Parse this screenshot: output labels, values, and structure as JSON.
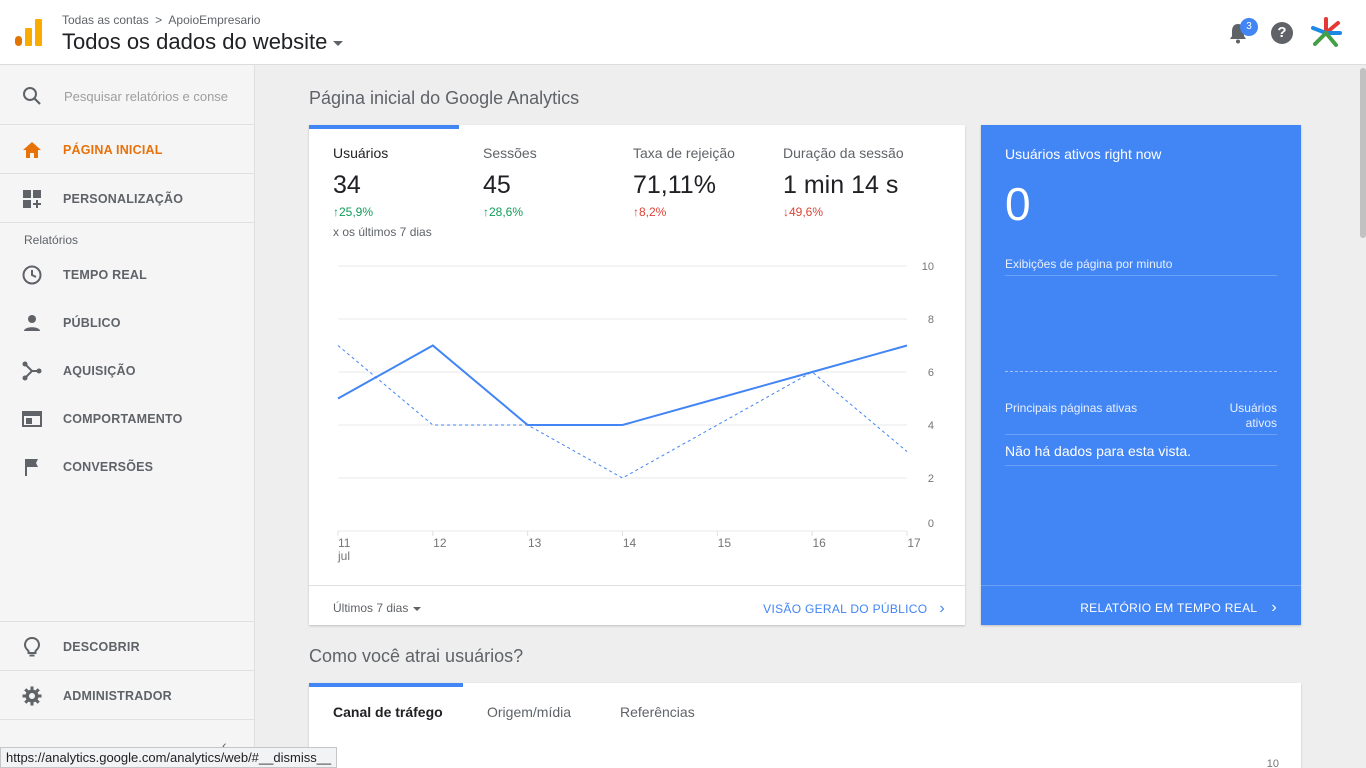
{
  "header": {
    "breadcrumb_root": "Todas as contas",
    "breadcrumb_sep": ">",
    "breadcrumb_account": "ApoioEmpresario",
    "view_title": "Todos os dados do website",
    "notification_count": "3",
    "help_glyph": "?"
  },
  "sidebar": {
    "search_placeholder": "Pesquisar relatórios e conse",
    "section_label": "Relatórios",
    "items": [
      {
        "label": "PÁGINA INICIAL",
        "icon": "home-icon"
      },
      {
        "label": "PERSONALIZAÇÃO",
        "icon": "dashboard-icon"
      },
      {
        "label": "TEMPO REAL",
        "icon": "clock-icon"
      },
      {
        "label": "PÚBLICO",
        "icon": "person-icon"
      },
      {
        "label": "AQUISIÇÃO",
        "icon": "acquisition-icon"
      },
      {
        "label": "COMPORTAMENTO",
        "icon": "browser-window-icon"
      },
      {
        "label": "CONVERSÕES",
        "icon": "flag-icon"
      },
      {
        "label": "DESCOBRIR",
        "icon": "lightbulb-icon"
      },
      {
        "label": "ADMINISTRADOR",
        "icon": "gear-icon"
      }
    ]
  },
  "main": {
    "title": "Página inicial do Google Analytics",
    "metrics": [
      {
        "label": "Usuários",
        "value": "34",
        "delta": "↑25,9%",
        "trend": "up",
        "note": "x os últimos 7 dias"
      },
      {
        "label": "Sessões",
        "value": "45",
        "delta": "↑28,6%",
        "trend": "up"
      },
      {
        "label": "Taxa de rejeição",
        "value": "71,11%",
        "delta": "↑8,2%",
        "trend": "down"
      },
      {
        "label": "Duração da sessão",
        "value": "1 min 14 s",
        "delta": "↓49,6%",
        "trend": "down"
      }
    ],
    "date_range": "Últimos 7 dias",
    "audience_link": "VISÃO GERAL DO PÚBLICO",
    "section2_title": "Como você atrai usuários?",
    "traffic_tabs": [
      "Canal de tráfego",
      "Origem/mídia",
      "Referências"
    ],
    "traffic_axis_top": "10"
  },
  "realtime": {
    "title": "Usuários ativos right now",
    "value": "0",
    "pageviews_label": "Exibições de página por minuto",
    "col_pages": "Principais páginas ativas",
    "col_users_1": "Usuários",
    "col_users_2": "ativos",
    "no_data": "Não há dados para esta vista.",
    "link": "RELATÓRIO EM TEMPO REAL"
  },
  "status_url": "https://analytics.google.com/analytics/web/#__dismiss__",
  "chart_data": {
    "type": "line",
    "x": [
      "11",
      "12",
      "13",
      "14",
      "15",
      "16",
      "17"
    ],
    "x_sublabel": "jul",
    "yticks": [
      "0",
      "2",
      "4",
      "6",
      "8",
      "10"
    ],
    "ylim": [
      0,
      10
    ],
    "series": [
      {
        "values": [
          5,
          7,
          4,
          4,
          5,
          6,
          7
        ],
        "style": "solid",
        "color": "#4285f4"
      },
      {
        "values": [
          7,
          4,
          4,
          2,
          4,
          6,
          3
        ],
        "style": "dashed",
        "color": "#4285f4"
      }
    ]
  },
  "colors": {
    "accent": "#4285f4",
    "active_nav": "#e8710a",
    "up": "#0f9d58",
    "down": "#db4437"
  }
}
